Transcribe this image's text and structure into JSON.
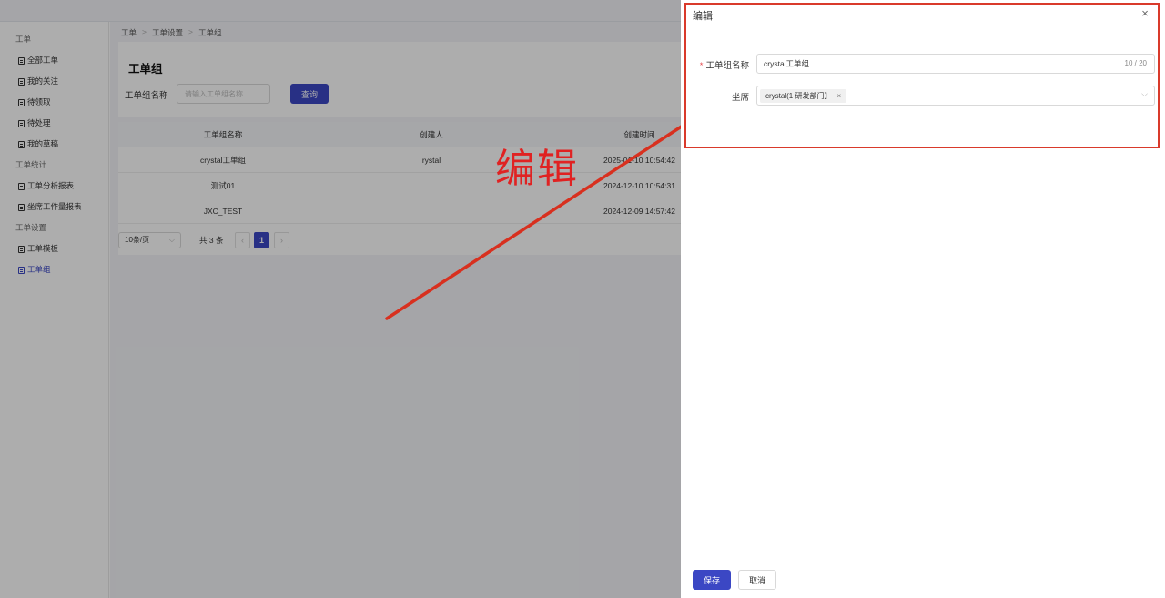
{
  "sidebar": {
    "groups": [
      {
        "title": "工单",
        "items": [
          "全部工单",
          "我的关注",
          "待领取",
          "待处理",
          "我的草稿"
        ]
      },
      {
        "title": "工单统计",
        "items": [
          "工单分析报表",
          "坐席工作量报表"
        ]
      },
      {
        "title": "工单设置",
        "items": [
          "工单模板",
          "工单组"
        ]
      }
    ],
    "active_item": "工单组"
  },
  "breadcrumb": [
    "工单",
    "工单设置",
    "工单组"
  ],
  "page": {
    "title": "工单组",
    "search_label": "工单组名称",
    "search_placeholder": "请输入工单组名称",
    "query_button": "查询"
  },
  "table": {
    "columns": [
      "工单组名称",
      "创建人",
      "创建时间"
    ],
    "rows": [
      [
        "crystal工单组",
        "rystal",
        "2025-01-10 10:54:42"
      ],
      [
        "测试01",
        "",
        "2024-12-10 10:54:31"
      ],
      [
        "JXC_TEST",
        "",
        "2024-12-09 14:57:42"
      ]
    ]
  },
  "pagination": {
    "page_size": "10条/页",
    "total": "共 3 条",
    "current_page": "1",
    "prev": "‹",
    "next": "›"
  },
  "annotation": {
    "text": "编辑",
    "color": "#e02222"
  },
  "drawer": {
    "title": "编辑",
    "close_icon": "×",
    "fields": {
      "name_label": "工单组名称",
      "name_required_mark": "*",
      "name_value": "crystal工单组",
      "name_counter": "10 / 20",
      "agent_label": "坐席",
      "agent_tag": "crystal(1        研发部门】",
      "agent_tag_close": "×"
    },
    "save_button": "保存",
    "cancel_button": "取消"
  },
  "colors": {
    "primary": "#3b47c4",
    "highlight_box": "#d93a2b",
    "required": "#e5484d"
  }
}
